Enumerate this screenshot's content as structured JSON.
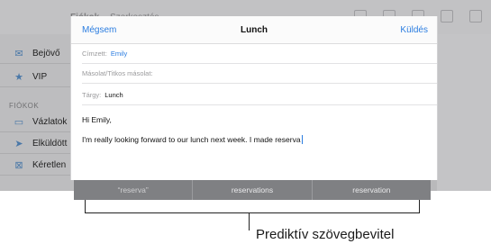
{
  "background_app": {
    "toolbar_title": "Fiókok",
    "toolbar_subtitle": "Szerkesztés",
    "sidebar": [
      {
        "label": "Bejövő",
        "icon": "inbox-icon"
      },
      {
        "label": "VIP",
        "icon": "star-icon"
      }
    ],
    "section_header": "FIÓKOK",
    "accounts": [
      {
        "label": "Vázlatok",
        "icon": "draft-icon"
      },
      {
        "label": "Elküldött",
        "icon": "sent-icon"
      },
      {
        "label": "Kéretlen",
        "icon": "junk-icon"
      }
    ]
  },
  "compose": {
    "cancel_label": "Mégsem",
    "title": "Lunch",
    "send_label": "Küldés",
    "to_label": "Címzett:",
    "to_value": "Emily",
    "cc_label": "Másolat/Titkos másolat:",
    "subject_label": "Tárgy:",
    "subject_value": "Lunch",
    "body_line1": "Hi Emily,",
    "body_line2": "I'm really looking forward to our lunch next week. I made reserva"
  },
  "predictive": {
    "suggestions": [
      "“reserva”",
      "reservations",
      "reservation"
    ]
  },
  "callout": {
    "label": "Prediktív szövegbevitel"
  },
  "colors": {
    "accent": "#2b7de0",
    "predictive_bar": "#7f8083"
  }
}
